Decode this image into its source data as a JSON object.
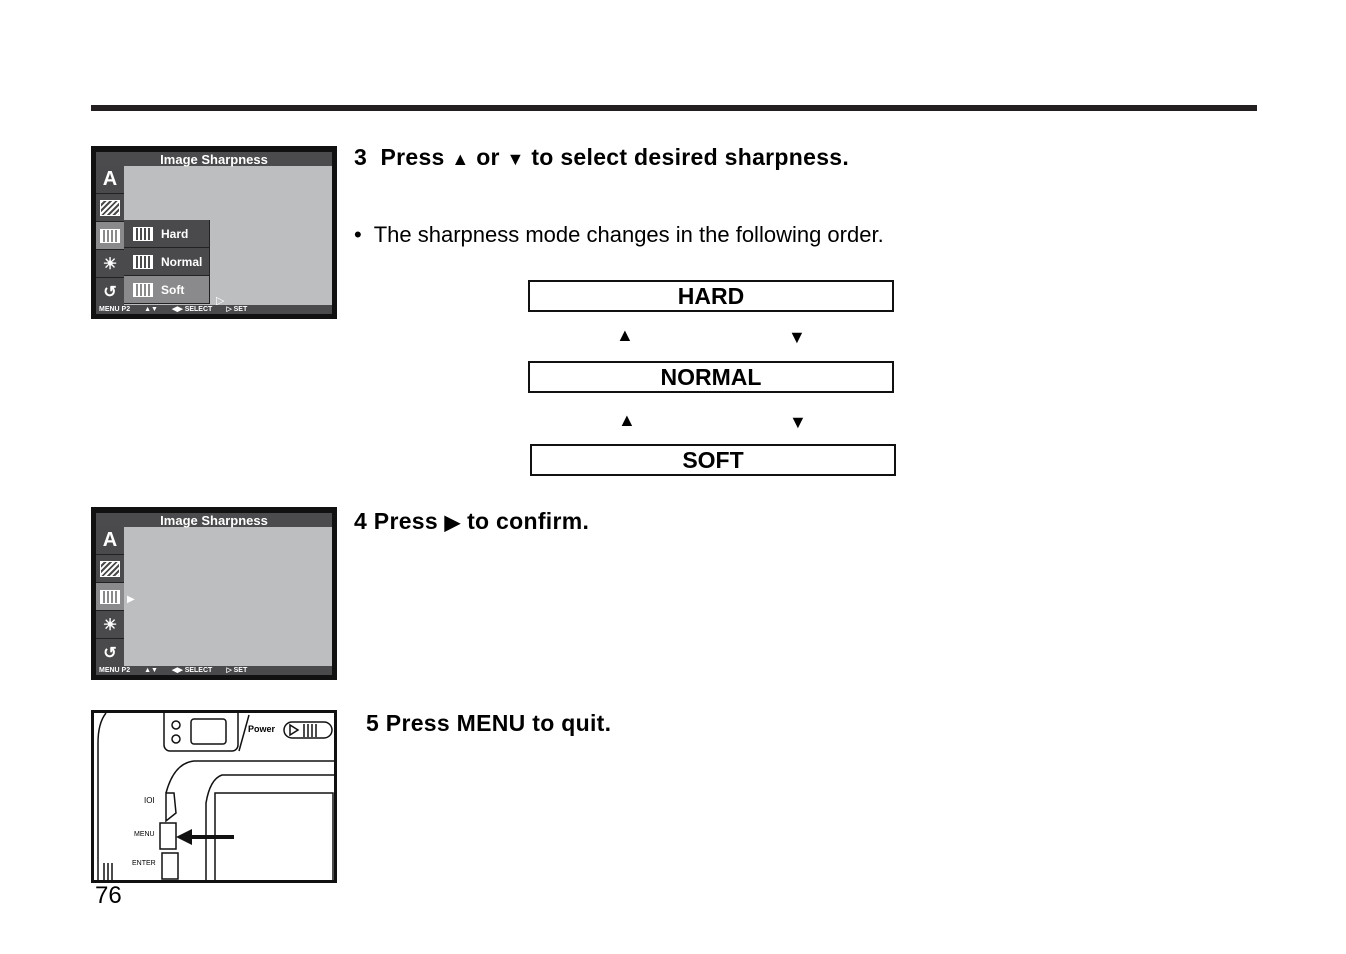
{
  "page_number": "76",
  "screen1": {
    "title": "Image Sharpness",
    "side_icons": [
      "auto-icon",
      "pattern-icon",
      "sharpness-icon",
      "brightness-icon",
      "reset-icon"
    ],
    "options": [
      "Hard",
      "Normal",
      "Soft"
    ],
    "selected_option": "Soft",
    "footer": [
      "MENU P2",
      "▲▼",
      "◀▶ SELECT",
      "▷ SET"
    ]
  },
  "screen2": {
    "title": "Image Sharpness",
    "footer": [
      "MENU P2",
      "▲▼",
      "◀▶ SELECT",
      "▷ SET"
    ]
  },
  "camera": {
    "power_label": "Power",
    "button_labels": [
      "IOI",
      "MENU",
      "ENTER"
    ]
  },
  "step3": {
    "number": "3",
    "text_a": "Press",
    "up": "▲",
    "text_b": "or",
    "down": "▼",
    "text_c": "to select desired sharpness.",
    "bullet": "The sharpness mode changes in the following order.",
    "order": [
      "HARD",
      "NORMAL",
      "SOFT"
    ]
  },
  "step4": {
    "number": "4",
    "text_a": "Press",
    "right": "▶",
    "text_b": "to confirm."
  },
  "step5": {
    "number": "5",
    "text": "Press MENU to quit."
  }
}
